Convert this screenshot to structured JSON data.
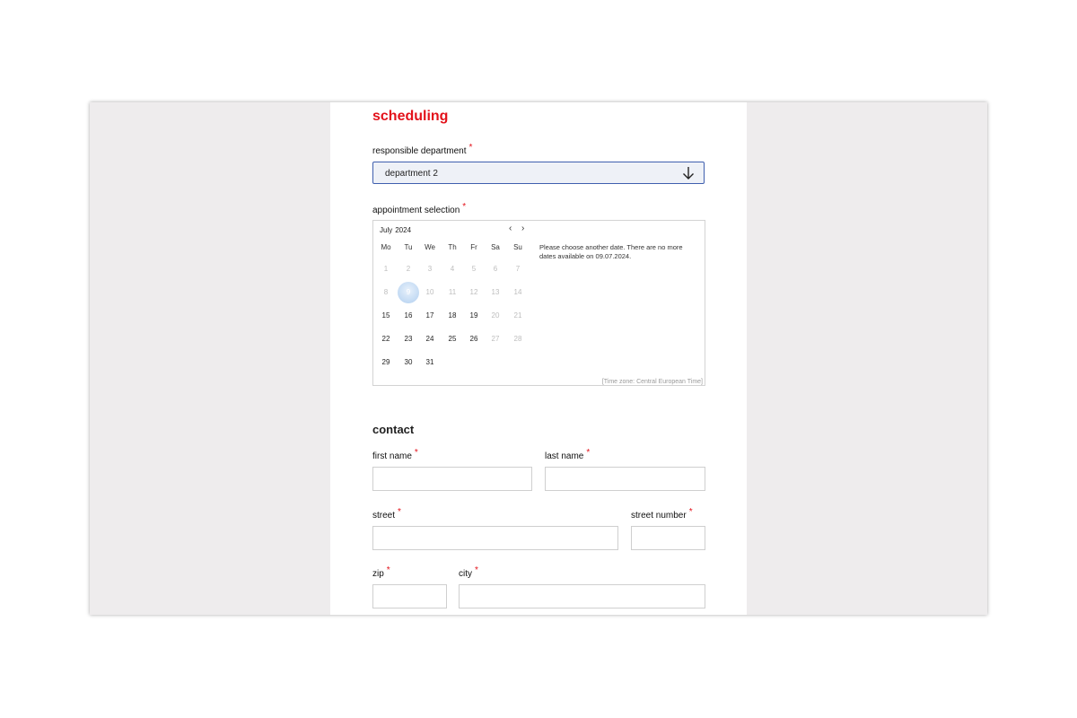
{
  "scheduling": {
    "title": "scheduling",
    "department_label": "responsible department",
    "department_value": "department 2",
    "appointment_label": "appointment selection",
    "required_mark": "*"
  },
  "calendar": {
    "month": "July",
    "year": "2024",
    "prev_icon": "chevron-left-icon",
    "next_icon": "chevron-right-icon",
    "prev_glyph": "‹",
    "next_glyph": "›",
    "weekdays": [
      "Mo",
      "Tu",
      "We",
      "Th",
      "Fr",
      "Sa",
      "Su"
    ],
    "weeks": [
      [
        {
          "d": "1",
          "s": "disabled"
        },
        {
          "d": "2",
          "s": "disabled"
        },
        {
          "d": "3",
          "s": "disabled"
        },
        {
          "d": "4",
          "s": "disabled"
        },
        {
          "d": "5",
          "s": "disabled"
        },
        {
          "d": "6",
          "s": "disabled"
        },
        {
          "d": "7",
          "s": "disabled"
        }
      ],
      [
        {
          "d": "8",
          "s": "disabled"
        },
        {
          "d": "9",
          "s": "selected"
        },
        {
          "d": "10",
          "s": "disabled"
        },
        {
          "d": "11",
          "s": "disabled"
        },
        {
          "d": "12",
          "s": "disabled"
        },
        {
          "d": "13",
          "s": "disabled"
        },
        {
          "d": "14",
          "s": "disabled"
        }
      ],
      [
        {
          "d": "15",
          "s": "enabled"
        },
        {
          "d": "16",
          "s": "enabled"
        },
        {
          "d": "17",
          "s": "enabled"
        },
        {
          "d": "18",
          "s": "enabled"
        },
        {
          "d": "19",
          "s": "enabled"
        },
        {
          "d": "20",
          "s": "disabled"
        },
        {
          "d": "21",
          "s": "disabled"
        }
      ],
      [
        {
          "d": "22",
          "s": "enabled"
        },
        {
          "d": "23",
          "s": "enabled"
        },
        {
          "d": "24",
          "s": "enabled"
        },
        {
          "d": "25",
          "s": "enabled"
        },
        {
          "d": "26",
          "s": "enabled"
        },
        {
          "d": "27",
          "s": "disabled"
        },
        {
          "d": "28",
          "s": "disabled"
        }
      ],
      [
        {
          "d": "29",
          "s": "enabled"
        },
        {
          "d": "30",
          "s": "enabled"
        },
        {
          "d": "31",
          "s": "enabled"
        }
      ]
    ],
    "message": "Please choose another date. There are no more dates available on 09.07.2024.",
    "timezone": "[Time zone: Central European Time]"
  },
  "contact": {
    "title": "contact",
    "first_name_label": "first name",
    "last_name_label": "last name",
    "street_label": "street",
    "street_number_label": "street number",
    "zip_label": "zip",
    "city_label": "city",
    "first_name_value": "",
    "last_name_value": "",
    "street_value": "",
    "street_number_value": "",
    "zip_value": "",
    "city_value": ""
  },
  "colors": {
    "accent_red": "#e3121b",
    "select_border": "#3f5fae",
    "backdrop": "#eeeced",
    "selected_day": "#bcd6f2"
  }
}
